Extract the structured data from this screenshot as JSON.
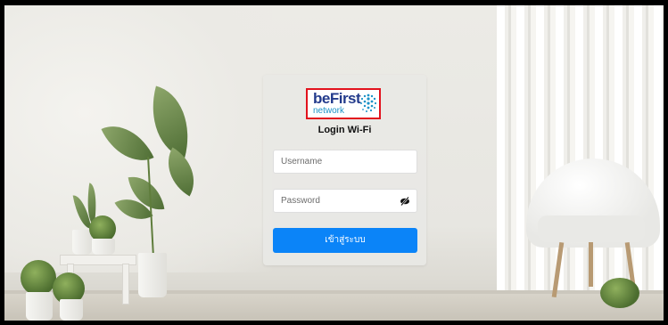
{
  "login": {
    "logo_brand": "beFirst",
    "logo_sub": "network",
    "title": "Login Wi-Fi",
    "username_placeholder": "Username",
    "password_placeholder": "Password",
    "submit_label": "เข้าสู่ระบบ"
  },
  "colors": {
    "button": "#0b84f8",
    "logo_border": "#e2121d"
  },
  "icons": {
    "password_toggle": "eye-slash-icon"
  }
}
